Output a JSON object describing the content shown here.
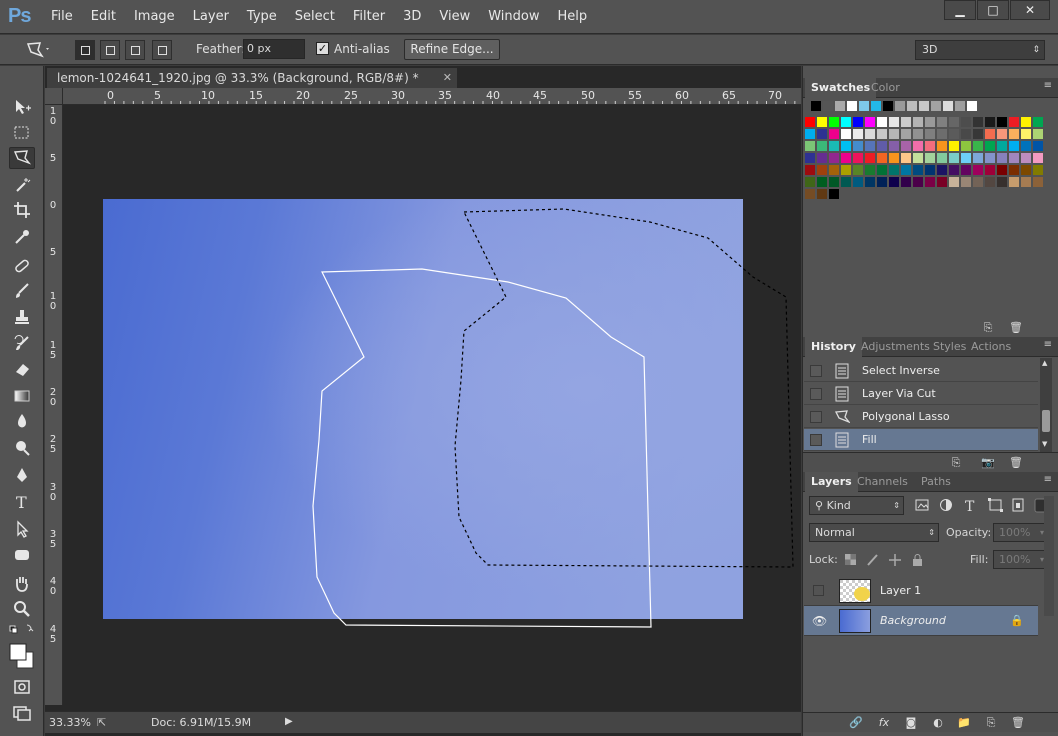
{
  "app": {
    "logo": "Ps"
  },
  "menus": [
    "File",
    "Edit",
    "Image",
    "Layer",
    "Type",
    "Select",
    "Filter",
    "3D",
    "View",
    "Window",
    "Help"
  ],
  "window_controls": {
    "minimize": "▁",
    "maximize": "□",
    "close": "✕"
  },
  "options": {
    "feather_label": "Feather:",
    "feather_value": "0 px",
    "antialias_label": "Anti-alias",
    "antialias_checked": "✓",
    "refine_label": "Refine Edge...",
    "workspace": "3D"
  },
  "document": {
    "tab_title": "lemon-1024641_1920.jpg @ 33.3% (Background, RGB/8#) *",
    "close_glyph": "✕",
    "ruler_top": [
      "0",
      "5",
      "10",
      "15",
      "20",
      "25",
      "30",
      "35",
      "40",
      "45",
      "50",
      "55",
      "60",
      "65",
      "70"
    ],
    "ruler_left": [
      "1\n0",
      "5",
      "0",
      "5",
      "1\n0",
      "1\n5",
      "2\n0",
      "2\n5",
      "3\n0",
      "3\n5",
      "4\n0",
      "4\n5"
    ],
    "canvas_colors": {
      "left": "#4a6bd1",
      "right": "#8fa2e0"
    }
  },
  "status": {
    "zoom": "33.33%",
    "export_glyph": "⇱",
    "doc": "Doc: 6.91M/15.9M",
    "play_glyph": "▶"
  },
  "swatches_panel": {
    "tabs": [
      "Swatches",
      "Color"
    ],
    "menu_glyph": "≡",
    "recent": [
      "#000000",
      "#555555",
      "#aaaaaa",
      "#ffffff",
      "#7ec9e8",
      "#23b7e6",
      "#000000",
      "#9a9a9a",
      "#bdbdbd",
      "#c9c9c9",
      "#a2a2a2",
      "#dcdcdc",
      "#9e9e9e",
      "#ffffff"
    ],
    "rows": [
      [
        "#ff0000",
        "#ffff00",
        "#00ff00",
        "#00ffff",
        "#0000ff",
        "#ff00ff",
        "#ffffff",
        "#e6e6e6",
        "#cccccc",
        "#b3b3b3",
        "#999999",
        "#808080",
        "#666666",
        "#4d4d4d",
        "#333333",
        "#1a1a1a",
        "#000000",
        "#ed1c24",
        "#fff200",
        "#00a651"
      ],
      [
        "#00aeef",
        "#2e3192",
        "#ec008c",
        "#ffffff",
        "#ebebeb",
        "#d9d9d9",
        "#c7c7c7",
        "#b5b5b5",
        "#a3a3a3",
        "#919191",
        "#7f7f7f",
        "#6d6d6d",
        "#5b5b5b",
        "#494949",
        "#373737",
        "#f26c4f",
        "#f7977a",
        "#fbaf5d",
        "#fff468",
        "#acd373"
      ],
      [
        "#7cc576",
        "#3bb878",
        "#1abbb4",
        "#00bff3",
        "#448ccb",
        "#5674b9",
        "#605ca8",
        "#855fa8",
        "#a763a8",
        "#f06eaa",
        "#f26d7d",
        "#f7941d",
        "#fff200",
        "#8dc63f",
        "#39b54a",
        "#00a651",
        "#00a99d",
        "#00aeef",
        "#0072bc",
        "#0054a6"
      ],
      [
        "#2e3192",
        "#662d91",
        "#92278f",
        "#ec008c",
        "#ed145b",
        "#ed1c24",
        "#f26522",
        "#f7941d",
        "#fdc689",
        "#c4df9b",
        "#a3d39c",
        "#82ca9d",
        "#7accc8",
        "#6dcff6",
        "#7da7d9",
        "#8393ca",
        "#8781bd",
        "#a186be",
        "#bd8cbf",
        "#f49ac1"
      ],
      [
        "#9e0b0f",
        "#a0410d",
        "#a36209",
        "#aba000",
        "#598527",
        "#197b30",
        "#007236",
        "#00746b",
        "#0076a3",
        "#004b80",
        "#003471",
        "#1b1464",
        "#440e62",
        "#630460",
        "#9e005d",
        "#9e0039",
        "#790000",
        "#7b2e00",
        "#7d4900",
        "#827b00"
      ],
      [
        "#406618",
        "#005e20",
        "#005826",
        "#005952",
        "#005b7f",
        "#003663",
        "#002157",
        "#0d004c",
        "#32004b",
        "#4b0049",
        "#7b0046",
        "#7a0026",
        "#c7b299",
        "#998675",
        "#736357",
        "#534741",
        "#37302d",
        "#c69c6d",
        "#a67c52",
        "#8c6239"
      ],
      [
        "#754c24",
        "#603913",
        "#000000"
      ]
    ]
  },
  "history_panel": {
    "tabs": [
      "History",
      "Adjustments",
      "Styles",
      "Actions"
    ],
    "menu_glyph": "≡",
    "items": [
      {
        "label": "Select Inverse",
        "icon": "document-icon"
      },
      {
        "label": "Layer Via Cut",
        "icon": "document-icon"
      },
      {
        "label": "Polygonal Lasso",
        "icon": "lasso-icon"
      },
      {
        "label": "Fill",
        "icon": "document-icon",
        "selected": true
      }
    ],
    "footer_glyphs": [
      "⎘",
      "📷",
      "🗑"
    ]
  },
  "layers_panel": {
    "tabs": [
      "Layers",
      "Channels",
      "Paths"
    ],
    "menu_glyph": "≡",
    "filter": "Kind",
    "blend_mode": "Normal",
    "opacity_label": "Opacity:",
    "opacity_value": "100%",
    "lock_label": "Lock:",
    "fill_label": "Fill:",
    "fill_value": "100%",
    "layers": [
      {
        "name": "Layer 1",
        "visible": false
      },
      {
        "name": "Background",
        "visible": true,
        "locked": true,
        "selected": true
      }
    ],
    "eye_glyph": "👁",
    "lock_glyph": "🔒",
    "footer_glyphs": [
      "🔗",
      "fx",
      "◙",
      "◐",
      "📁",
      "⎘",
      "🗑"
    ]
  }
}
